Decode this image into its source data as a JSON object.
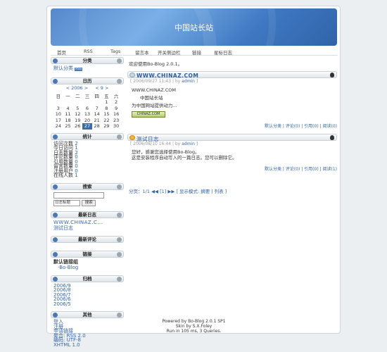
{
  "site": {
    "title": "中国站长站"
  },
  "nav": [
    "首页",
    "RSS",
    "Tags",
    "留言本",
    "开关侧边栏",
    "链接",
    "星标日志"
  ],
  "sidebar": {
    "category": {
      "title": "分类",
      "item": "默认分类"
    },
    "calendar": {
      "title": "日历",
      "prev": "< 2006 >",
      "month": "< 9 >",
      "weekdays": [
        "日",
        "一",
        "二",
        "三",
        "四",
        "五",
        "六"
      ],
      "rows": [
        [
          "",
          "",
          "",
          "",
          "",
          "1",
          "2"
        ],
        [
          "3",
          "4",
          "5",
          "6",
          "7",
          "8",
          "9"
        ],
        [
          "10",
          "11",
          "12",
          "13",
          "14",
          "15",
          "16"
        ],
        [
          "17",
          "18",
          "19",
          "20",
          "21",
          "22",
          "23"
        ],
        [
          "24",
          "25",
          "26",
          "27",
          "28",
          "29",
          "30"
        ]
      ],
      "today": "27"
    },
    "stats": {
      "title": "统计",
      "lines": [
        [
          "访问次数",
          "2"
        ],
        [
          "今日访问",
          "1"
        ],
        [
          "日志数量",
          "2"
        ],
        [
          "评论数量",
          "0"
        ],
        [
          "引用数量",
          "0"
        ],
        [
          "留言数量",
          "0"
        ],
        [
          "注册用户",
          "0"
        ],
        [
          "在线人数",
          "1"
        ]
      ]
    },
    "search": {
      "title": "搜索",
      "select": "日志标题",
      "button": "搜索"
    },
    "latest": {
      "title": "最新日志",
      "item": "WWW.CHINAZ.C...",
      "item2": "测试日志"
    },
    "comments": {
      "title": "最新评论"
    },
    "links": {
      "title": "链接",
      "group": "默认链接组",
      "item": "Bo-Blog"
    },
    "archive": {
      "title": "归档",
      "items": [
        "2006/9",
        "2006/8",
        "2006/7",
        "2006/6",
        "2006/5"
      ]
    },
    "other": {
      "title": "其他",
      "items": [
        "登入",
        "注册",
        "申请链接",
        "聚合: RSS 2.0",
        "编码: UTF-8",
        "XHTML 1.0"
      ]
    }
  },
  "main": {
    "welcome": "欢迎使用Bo-Blog 2.0.1。",
    "posts": [
      {
        "title": "WWW.CHINAZ.COM",
        "date": "2006/09/27 11:43",
        "author": "admin",
        "body": [
          "WWW.CHINAZ.COM",
          "中国站长站",
          "为中国网站提供动力..."
        ],
        "badge": "CHINAZ.COM",
        "foot": "默认分类 | 评论(0) | 引用(0) | 阅读(0)"
      },
      {
        "title": "测试日志",
        "date": "2006/08/10 16:44",
        "author": "admin",
        "body": [
          "您好，感谢您选择使用Bo-Blog。",
          "这是安装程序自动写入的一篇日志。您可以删除它。"
        ],
        "foot": "默认分类 | 评论(0) | 引用(0) | 阅读(1)"
      }
    ],
    "pager": "分页：1/1 ◀◀ [1] ▶▶ [ 显示模式: 摘要 | 列表 ]"
  },
  "footer": [
    "Powered by Bo-Blog 2.0.1 SP1",
    "Skin by S.X.Foley",
    "Run in 105 ms, 3 Queries."
  ]
}
